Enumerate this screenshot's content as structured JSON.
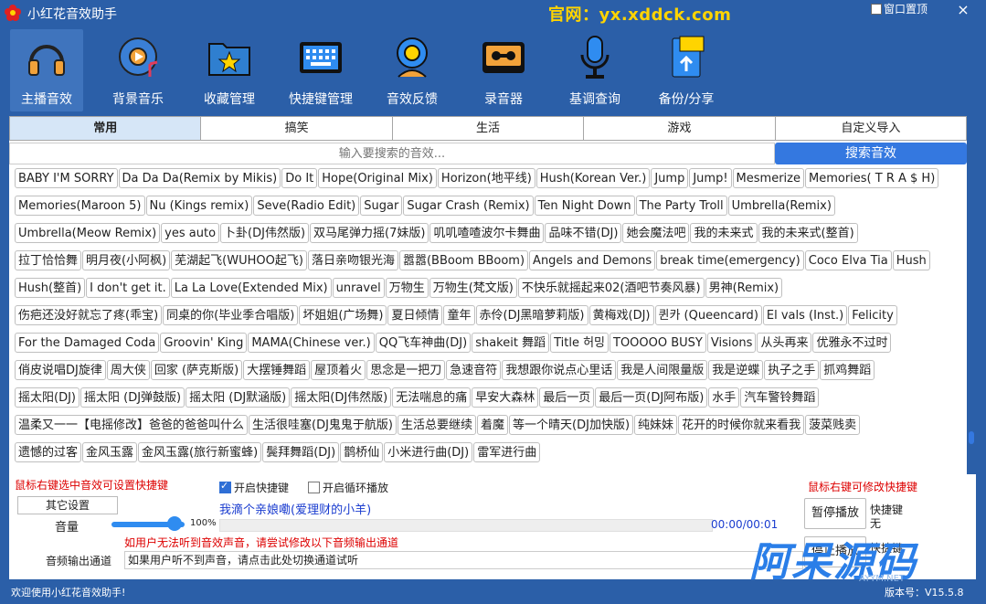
{
  "window": {
    "title": "小红花音效助手",
    "site_label": "官网：yx.xddck.com",
    "pin_label": "窗口置顶",
    "close_glyph": "×"
  },
  "toolbar": [
    {
      "label": "主播音效",
      "icon": "headphones-icon",
      "active": true
    },
    {
      "label": "背景音乐",
      "icon": "music-disc-icon",
      "active": false
    },
    {
      "label": "收藏管理",
      "icon": "star-folder-icon",
      "active": false
    },
    {
      "label": "快捷键管理",
      "icon": "keyboard-icon",
      "active": false
    },
    {
      "label": "音效反馈",
      "icon": "feedback-icon",
      "active": false
    },
    {
      "label": "录音器",
      "icon": "cassette-icon",
      "active": false
    },
    {
      "label": "基调查询",
      "icon": "microphone-icon",
      "active": false
    },
    {
      "label": "备份/分享",
      "icon": "backup-icon",
      "active": false
    }
  ],
  "tabs": [
    {
      "label": "常用",
      "active": true
    },
    {
      "label": "搞笑",
      "active": false
    },
    {
      "label": "生活",
      "active": false
    },
    {
      "label": "游戏",
      "active": false
    },
    {
      "label": "自定义导入",
      "active": false
    }
  ],
  "search": {
    "placeholder": "输入要搜索的音效...",
    "button": "搜索音效"
  },
  "sounds": [
    [
      "BABY I'M SORRY",
      "Da Da Da(Remix by Mikis)",
      "Do It",
      "Hope(Original Mix)",
      "Horizon(地平线)",
      "Hush(Korean Ver.)",
      "Jump",
      "Jump!",
      "Mesmerize",
      "Memories( T R A $ H)"
    ],
    [
      "Memories(Maroon 5)",
      "Nu (Kings remix)",
      "Seve(Radio Edit)",
      "Sugar",
      "Sugar Crash (Remix)",
      "Ten Night Down",
      "The Party Troll",
      "Umbrella(Remix)"
    ],
    [
      "Umbrella(Meow Remix)",
      "yes auto",
      "卜卦(DJ伟然版)",
      "双马尾弹力摇(7妹版)",
      "叽叽喳喳波尔卡舞曲",
      "品味不错(DJ)",
      "她会魔法吧",
      "我的未来式",
      "我的未来式(整首)"
    ],
    [
      "拉丁恰恰舞",
      "明月夜(小阿枫)",
      "芜湖起飞(WUHOO起飞)",
      "落日亲吻银光海",
      "嚣嚣(BBoom BBoom)",
      "Angels and Demons",
      "break time(emergency)",
      "Coco Elva Tia",
      "Hush"
    ],
    [
      "Hush(整首)",
      "I don't get it.",
      "La La Love(Extended Mix)",
      "unravel",
      "万物生",
      "万物生(梵文版)",
      "不快乐就摇起来02(酒吧节奏风暴)",
      "男神(Remix)"
    ],
    [
      "伤疤还没好就忘了疼(乖宝)",
      "同桌的你(毕业季合唱版)",
      "坏姐姐(广场舞)",
      "夏日倾情",
      "童年",
      "赤伶(DJ黑暗萝莉版)",
      "黄梅戏(DJ)",
      "퀸카 (Queencard)",
      "El vals (Inst.)",
      "Felicity"
    ],
    [
      "For the Damaged Coda",
      "Groovin' King",
      "MAMA(Chinese ver.)",
      "QQ飞车神曲(DJ)",
      "shakeit 舞蹈",
      "Title 허밍",
      "TOOOOO BUSY",
      "Visions",
      "从头再来",
      "优雅永不过时"
    ],
    [
      "俏皮说唱DJ旋律",
      "周大侠",
      "回家 (萨克斯版)",
      "大摆锤舞蹈",
      "屋顶着火",
      "思念是一把刀",
      "急速音符",
      "我想跟你说点心里话",
      "我是人间限量版",
      "我是逆蝶",
      "执子之手",
      "抓鸡舞蹈"
    ],
    [
      "摇太阳(DJ)",
      "摇太阳 (DJ弹鼓版)",
      "摇太阳 (DJ默涵版)",
      "摇太阳(DJ伟然版)",
      "无法喘息的痛",
      "早安大森林",
      "最后一页",
      "最后一页(DJ阿布版)",
      "水手",
      "汽车警铃舞蹈"
    ],
    [
      "温柔又一一【电摇修改】爸爸的爸爸叫什么",
      "生活很哇塞(DJ鬼鬼于航版)",
      "生活总要继续",
      "着魔",
      "等一个晴天(DJ加快版)",
      "纯妹妹",
      "花开的时候你就来看我",
      "菠菜贱卖"
    ],
    [
      "遗憾的过客",
      "金风玉露",
      "金风玉露(旅行新蜜蜂)",
      "鬓拜舞蹈(DJ)",
      "鹊桥仙",
      "小米进行曲(DJ)",
      "雷军进行曲"
    ]
  ],
  "controls": {
    "hint_left": "鼠标右键选中音效可设置快捷键",
    "hint_right": "鼠标右键可修改快捷键",
    "enable_hotkey": {
      "label": "开启快捷键",
      "checked": true
    },
    "loop_play": {
      "label": "开启循环播放",
      "checked": false
    },
    "other_settings": "其它设置",
    "now_playing": "我滴个亲娘嘞(爱理财的小羊)",
    "volume_label": "音量",
    "volume_value": "100%",
    "volume_level": 1.0,
    "time": "00:00/00:01",
    "warning": "如用户无法听到音效声音，请尝试修改以下音频输出通道",
    "output_label": "音频输出通道",
    "output_value": "如果用户听不到声音，请点击此处切换通道试听",
    "pause_button": "暂停播放",
    "hotkey_label": "快捷键",
    "hotkey_value": "无",
    "stop_button": "停止播放",
    "hotkey2_label": "快捷键"
  },
  "watermark": {
    "main": "阿呆源码",
    "sub": "AYYM.NET"
  },
  "status": {
    "left": "欢迎使用小红花音效助手!",
    "right": "版本号：V15.5.8"
  }
}
